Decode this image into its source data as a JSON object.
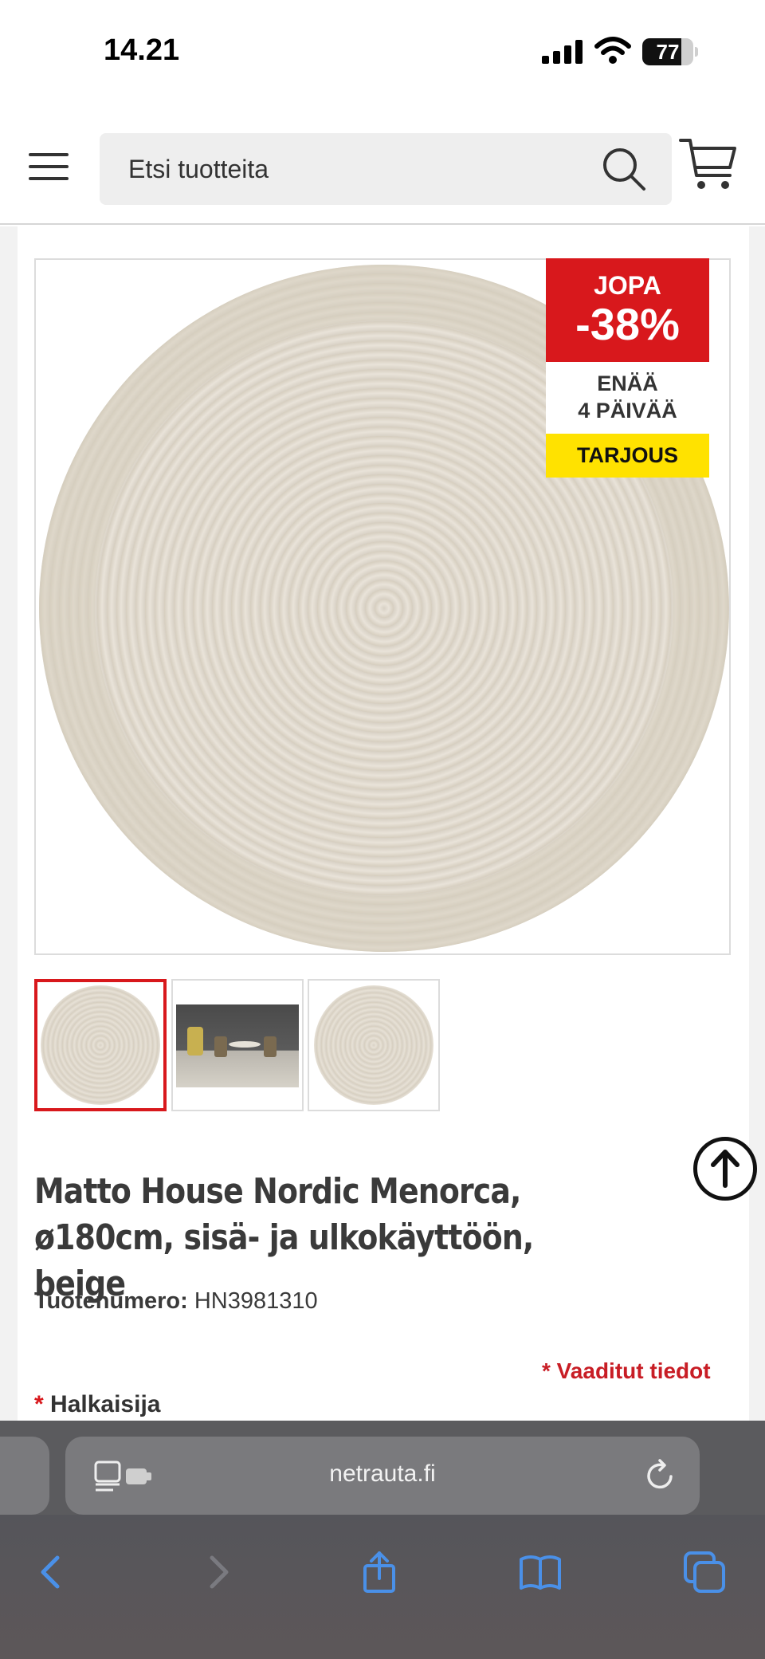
{
  "status_bar": {
    "time": "14.21",
    "battery": "77",
    "battery_level": 0.77
  },
  "header": {
    "search_placeholder": "Etsi tuotteita"
  },
  "promo": {
    "line1": "JOPA",
    "discount": "-38%",
    "line2": "ENÄÄ",
    "line3": "4 PÄIVÄÄ",
    "tag": "TARJOUS",
    "colors": {
      "red": "#d8181c",
      "yellow": "#ffe200"
    }
  },
  "thumbnails": [
    {
      "name": "rug-top-view",
      "active": true
    },
    {
      "name": "rug-outdoor-scene",
      "active": false
    },
    {
      "name": "rug-top-view-2",
      "active": false
    }
  ],
  "product": {
    "title": "Matto House Nordic Menorca, ø180cm, sisä- ja ulkokäyttöön, beige",
    "sku_label": "Tuotenumero:",
    "sku_value": "HN3981310",
    "required_note": "* Vaaditut tiedot",
    "field_asterisk": "*",
    "field_label": "Halkaisija"
  },
  "browser": {
    "address": "netrauta.fi"
  }
}
